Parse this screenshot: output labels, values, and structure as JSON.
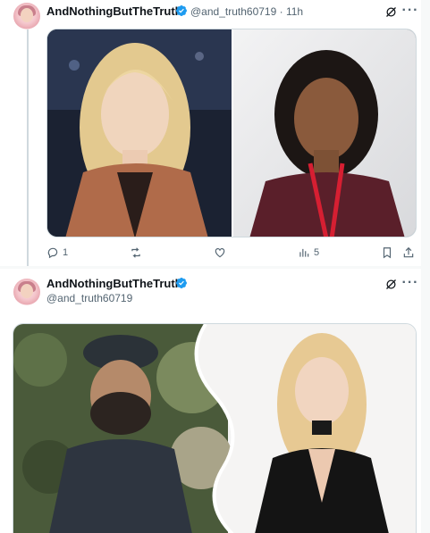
{
  "tweet1": {
    "display_name": "AndNothingButTheTruth",
    "handle": "@and_truth60719",
    "separator": "·",
    "time": "11h",
    "media_description_icon": "photo",
    "actions": {
      "reply_count": "1",
      "retweet_count": "",
      "like_count": "",
      "views_count": "5"
    }
  },
  "tweet2": {
    "display_name": "AndNothingButTheTruth",
    "handle": "@and_truth60719"
  },
  "icons": {
    "verified": "verified-badge-icon",
    "grok": "grok-icon",
    "more": "more-icon",
    "reply": "reply-icon",
    "retweet": "retweet-icon",
    "like": "like-icon",
    "views": "views-icon",
    "bookmark": "bookmark-icon",
    "share": "share-icon"
  },
  "colors": {
    "verified_blue": "#1d9bf0",
    "secondary_text": "#536471",
    "primary_text": "#0f1419",
    "divider": "#cfd9de"
  }
}
